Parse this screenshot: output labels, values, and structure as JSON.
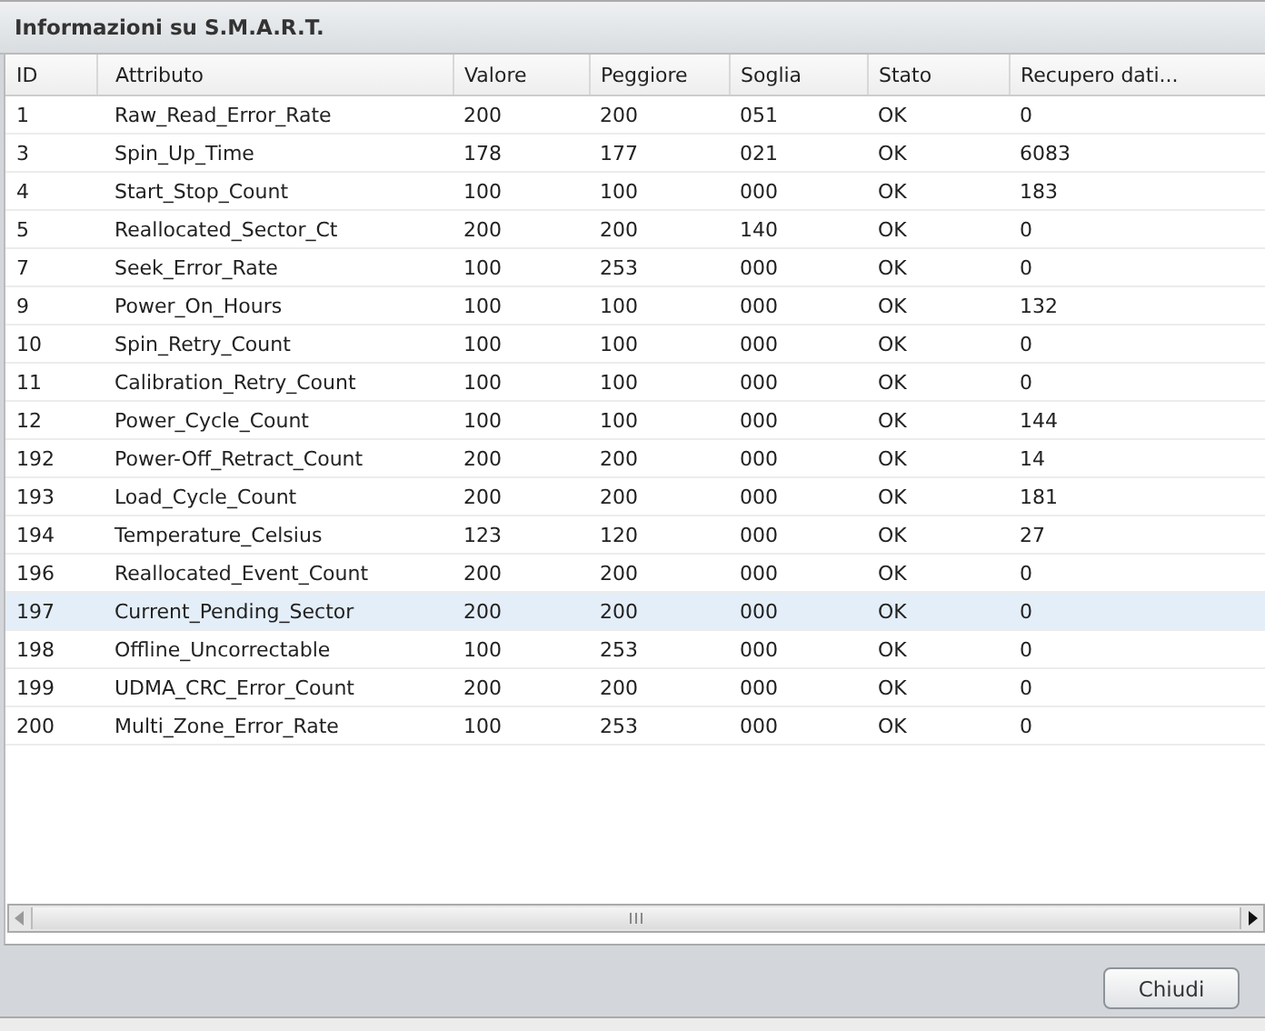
{
  "window": {
    "title": "Informazioni su S.M.A.R.T."
  },
  "table": {
    "columns": [
      "ID",
      "Attributo",
      "Valore",
      "Peggiore",
      "Soglia",
      "Stato",
      "Recupero dati..."
    ],
    "rows": [
      {
        "cells": [
          "1",
          "Raw_Read_Error_Rate",
          "200",
          "200",
          "051",
          "OK",
          "0"
        ],
        "selected": false
      },
      {
        "cells": [
          "3",
          "Spin_Up_Time",
          "178",
          "177",
          "021",
          "OK",
          "6083"
        ],
        "selected": false
      },
      {
        "cells": [
          "4",
          "Start_Stop_Count",
          "100",
          "100",
          "000",
          "OK",
          "183"
        ],
        "selected": false
      },
      {
        "cells": [
          "5",
          "Reallocated_Sector_Ct",
          "200",
          "200",
          "140",
          "OK",
          "0"
        ],
        "selected": false
      },
      {
        "cells": [
          "7",
          "Seek_Error_Rate",
          "100",
          "253",
          "000",
          "OK",
          "0"
        ],
        "selected": false
      },
      {
        "cells": [
          "9",
          "Power_On_Hours",
          "100",
          "100",
          "000",
          "OK",
          "132"
        ],
        "selected": false
      },
      {
        "cells": [
          "10",
          "Spin_Retry_Count",
          "100",
          "100",
          "000",
          "OK",
          "0"
        ],
        "selected": false
      },
      {
        "cells": [
          "11",
          "Calibration_Retry_Count",
          "100",
          "100",
          "000",
          "OK",
          "0"
        ],
        "selected": false
      },
      {
        "cells": [
          "12",
          "Power_Cycle_Count",
          "100",
          "100",
          "000",
          "OK",
          "144"
        ],
        "selected": false
      },
      {
        "cells": [
          "192",
          "Power-Off_Retract_Count",
          "200",
          "200",
          "000",
          "OK",
          "14"
        ],
        "selected": false
      },
      {
        "cells": [
          "193",
          "Load_Cycle_Count",
          "200",
          "200",
          "000",
          "OK",
          "181"
        ],
        "selected": false
      },
      {
        "cells": [
          "194",
          "Temperature_Celsius",
          "123",
          "120",
          "000",
          "OK",
          "27"
        ],
        "selected": false
      },
      {
        "cells": [
          "196",
          "Reallocated_Event_Count",
          "200",
          "200",
          "000",
          "OK",
          "0"
        ],
        "selected": false
      },
      {
        "cells": [
          "197",
          "Current_Pending_Sector",
          "200",
          "200",
          "000",
          "OK",
          "0"
        ],
        "selected": true
      },
      {
        "cells": [
          "198",
          "Offline_Uncorrectable",
          "100",
          "253",
          "000",
          "OK",
          "0"
        ],
        "selected": false
      },
      {
        "cells": [
          "199",
          "UDMA_CRC_Error_Count",
          "200",
          "200",
          "000",
          "OK",
          "0"
        ],
        "selected": false
      },
      {
        "cells": [
          "200",
          "Multi_Zone_Error_Rate",
          "100",
          "253",
          "000",
          "OK",
          "0"
        ],
        "selected": false
      }
    ]
  },
  "buttons": [
    "Chiudi"
  ]
}
